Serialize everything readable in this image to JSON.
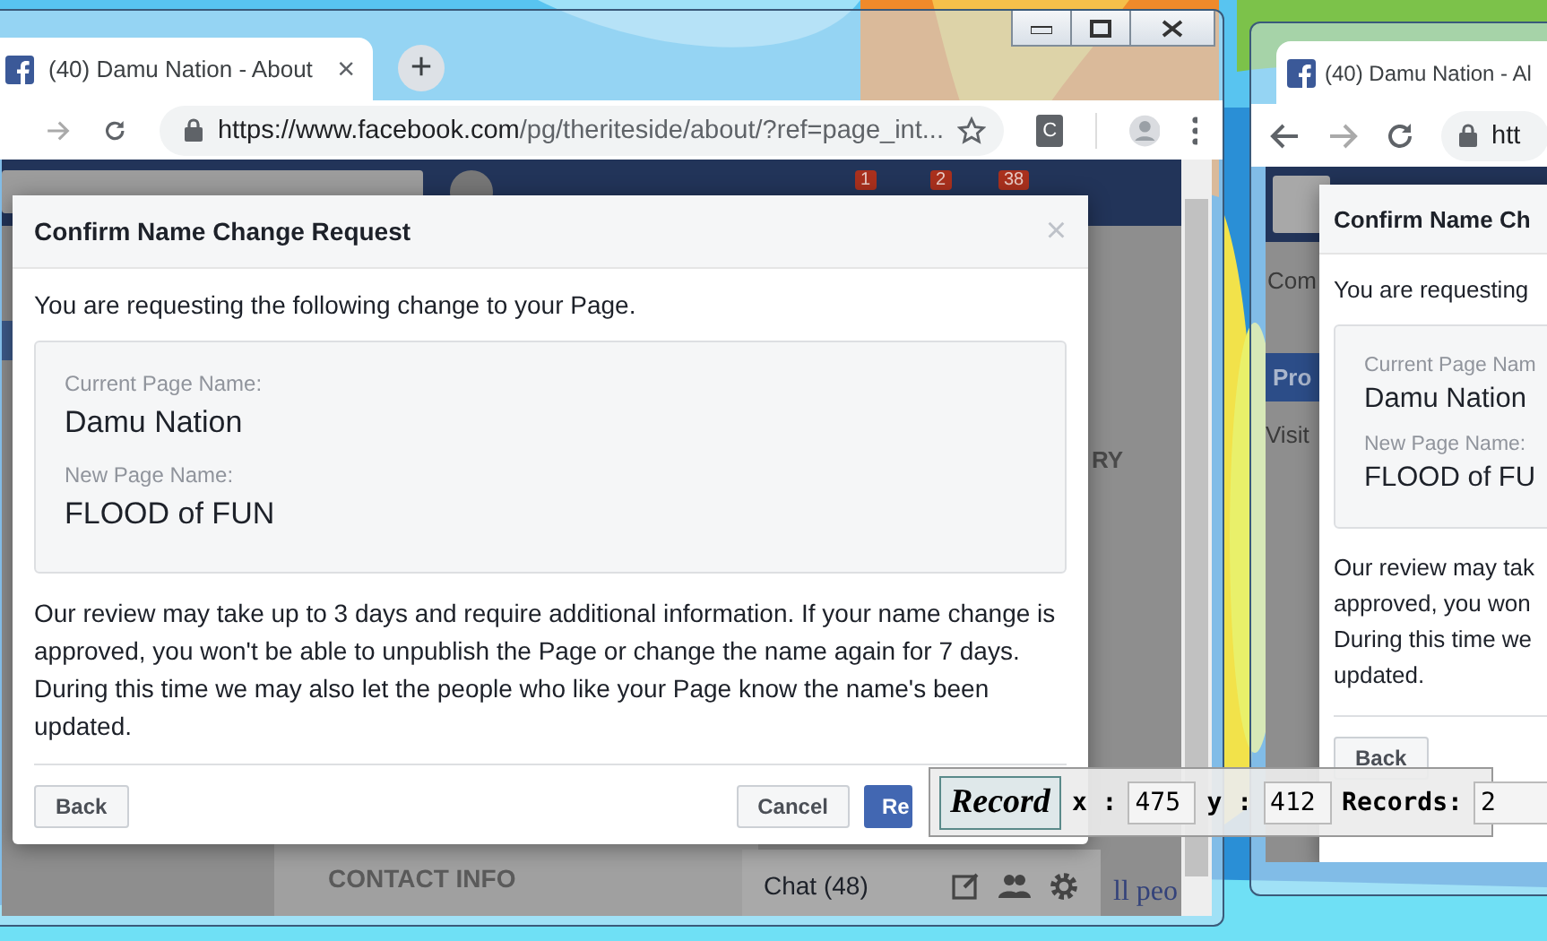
{
  "left_window": {
    "tab": {
      "title": "(40) Damu Nation - About",
      "close": "×"
    },
    "new_tab": "+",
    "address": {
      "host": "https://www.facebook.com",
      "path": "/pg/theriteside/about/?ref=page_int..."
    },
    "extension": "C",
    "facebook_bar": {
      "badges": [
        "1",
        "2",
        "38"
      ]
    },
    "page_fragments": {
      "right_heading": "RY",
      "contact": "CONTACT INFO",
      "people": "ll peo"
    },
    "chat": {
      "label": "Chat (48)"
    },
    "dialog": {
      "title": "Confirm Name Change Request",
      "close": "×",
      "intro": "You are requesting the following change to your Page.",
      "fields": [
        {
          "label": "Current Page Name:",
          "value": "Damu Nation"
        },
        {
          "label": "New Page Name:",
          "value": "FLOOD of FUN"
        }
      ],
      "notice": "Our review may take up to 3 days and require additional information. If your name change is approved, you won't be able to unpublish the Page or change the name again for 7 days. During this time we may also let the people who like your Page know the name's been updated.",
      "back": "Back",
      "cancel": "Cancel",
      "confirm": "Re"
    }
  },
  "right_window": {
    "tab": {
      "title": "(40) Damu Nation - Al"
    },
    "address": {
      "host": "htt"
    },
    "page_fragments": {
      "top": "Com",
      "button": "Pro",
      "bottom": "Visit"
    },
    "dialog": {
      "title": "Confirm Name Ch",
      "intro": "You are requesting",
      "fields": [
        {
          "label": "Current Page Nam",
          "value": "Damu Nation"
        },
        {
          "label": "New Page Name:",
          "value": "FLOOD of FU"
        }
      ],
      "notice_lines": [
        "Our review may tak",
        "approved, you won",
        "During this time we",
        "updated."
      ],
      "back": "Back"
    }
  },
  "record_bar": {
    "button": "Record",
    "x_label": "x :",
    "x_value": "475",
    "y_label": "y :",
    "y_value": "412",
    "count_label": "Records:",
    "count_value": "2"
  }
}
